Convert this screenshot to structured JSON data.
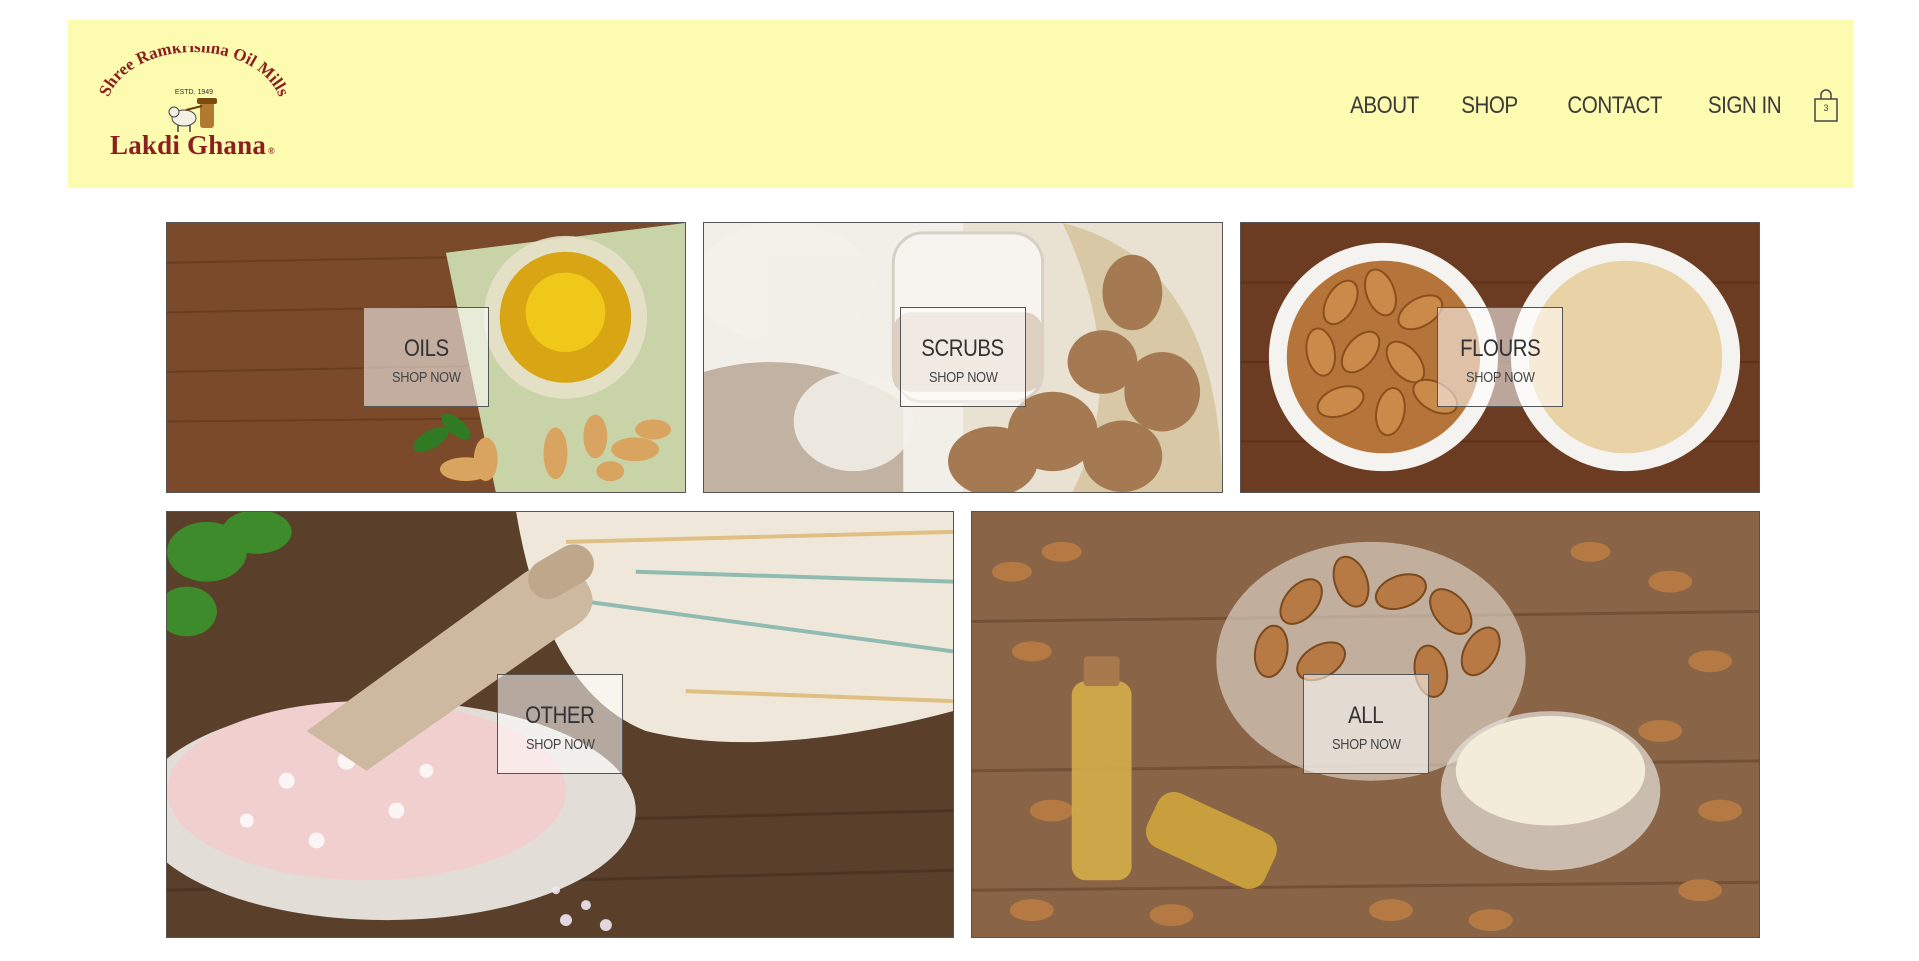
{
  "header": {
    "logo": {
      "arc_text": "Shree Ramkrishna Oil Mills",
      "established": "ESTD. 1949",
      "brand": "Lakdi Ghana",
      "registered_mark": "®",
      "icon": "oil-mill-ox-icon"
    },
    "nav": {
      "about": "ABOUT",
      "shop": "SHOP",
      "contact": "CONTACT",
      "sign_in": "SIGN IN"
    },
    "cart": {
      "icon": "shopping-bag-icon",
      "count": "3"
    },
    "background_color": "#fdfbb0",
    "brand_color": "#8b1e1e"
  },
  "categories": {
    "oils": {
      "title": "OILS",
      "cta": "SHOP NOW"
    },
    "scrubs": {
      "title": "SCRUBS",
      "cta": "SHOP NOW"
    },
    "flours": {
      "title": "FLOURS",
      "cta": "SHOP NOW"
    },
    "other": {
      "title": "OTHER",
      "cta": "SHOP NOW"
    },
    "all": {
      "title": "ALL",
      "cta": "SHOP NOW"
    }
  }
}
